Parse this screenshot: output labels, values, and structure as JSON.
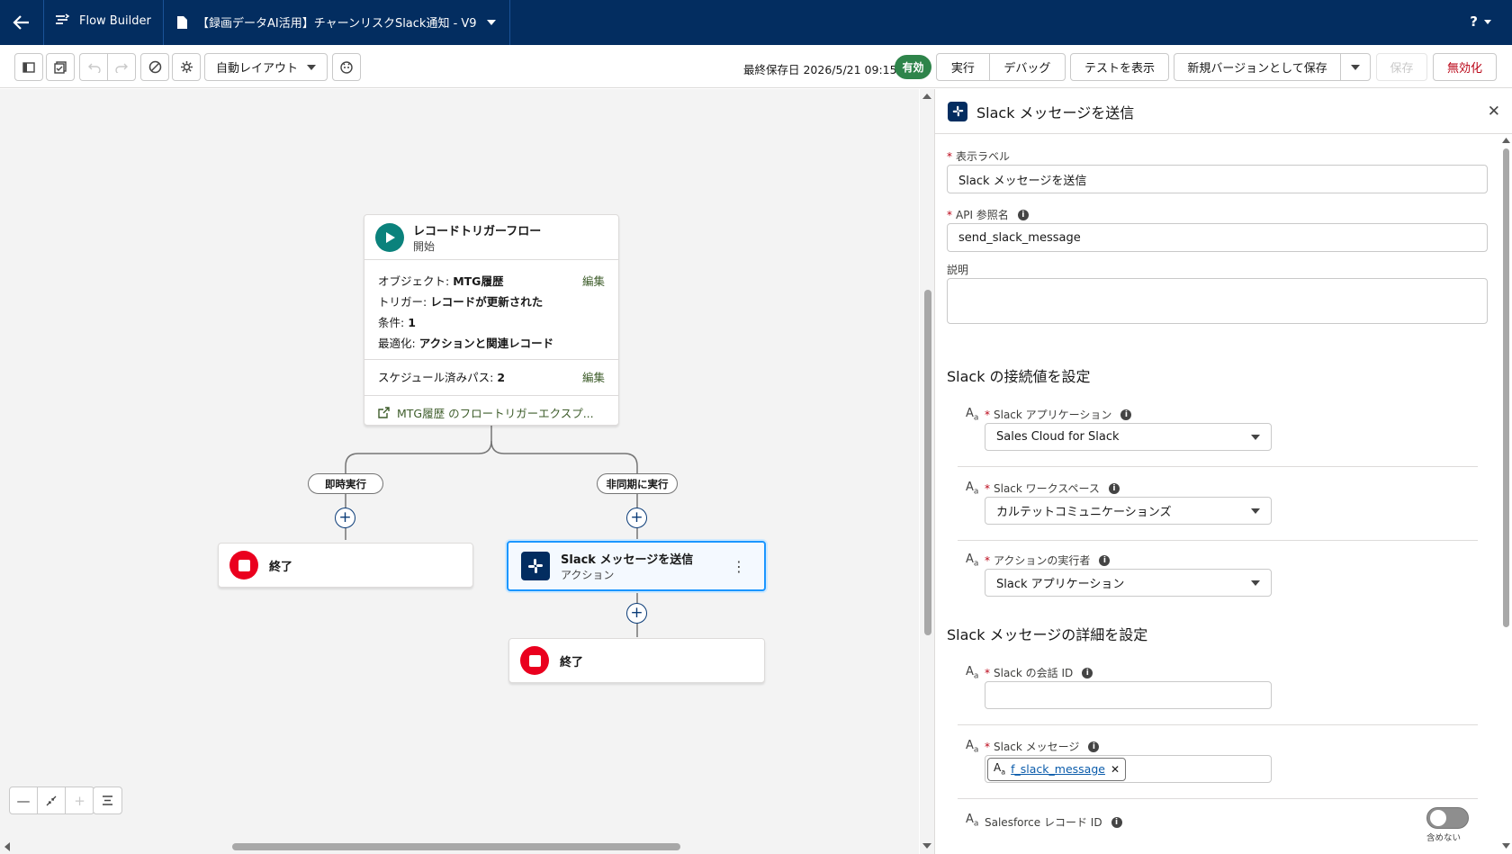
{
  "header": {
    "app_name": "Flow Builder",
    "flow_title": "【録画データAI活用】チャーンリスクSlack通知 - V9",
    "help_label": "?"
  },
  "toolbar": {
    "layout_select": "自動レイアウト",
    "last_saved": "最終保存日 2026/5/21 09:15",
    "status_badge": "有効",
    "run_label": "実行",
    "debug_label": "デバッグ",
    "view_tests_label": "テストを表示",
    "save_new_version_label": "新規バージョンとして保存",
    "save_label": "保存",
    "deactivate_label": "無効化"
  },
  "canvas": {
    "start": {
      "title": "レコードトリガーフロー",
      "subtitle": "開始",
      "object_label": "オブジェクト:",
      "object_value": "MTG履歴",
      "trigger_label": "トリガー:",
      "trigger_value": "レコードが更新された",
      "condition_label": "条件:",
      "condition_value": "1",
      "optimize_label": "最適化:",
      "optimize_value": "アクションと関連レコード",
      "edit_label": "編集",
      "scheduled_label": "スケジュール済みパス:",
      "scheduled_value": "2",
      "explorer_link": "MTG履歴 のフロートリガーエクスプ..."
    },
    "branches": {
      "immediate": "即時実行",
      "async": "非同期に実行"
    },
    "end_label": "終了",
    "action": {
      "title": "Slack メッセージを送信",
      "subtitle": "アクション"
    }
  },
  "panel": {
    "title": "Slack メッセージを送信",
    "label_field": {
      "label": "表示ラベル",
      "value": "Slack メッセージを送信"
    },
    "api_field": {
      "label": "API 参照名",
      "value": "send_slack_message"
    },
    "description_field": {
      "label": "説明",
      "value": ""
    },
    "section_connection": "Slack の接続値を設定",
    "slack_app": {
      "label": "Slack アプリケーション",
      "value": "Sales Cloud for Slack"
    },
    "slack_workspace": {
      "label": "Slack ワークスペース",
      "value": "カルテットコミュニケーションズ"
    },
    "action_runner": {
      "label": "アクションの実行者",
      "value": "Slack アプリケーション"
    },
    "section_details": "Slack メッセージの詳細を設定",
    "conversation_id": {
      "label": "Slack の会話 ID",
      "value": ""
    },
    "slack_message": {
      "label": "Slack メッセージ",
      "chip": "f_slack_message"
    },
    "record_id": {
      "label": "Salesforce レコード ID",
      "toggle_label": "含めない"
    }
  }
}
